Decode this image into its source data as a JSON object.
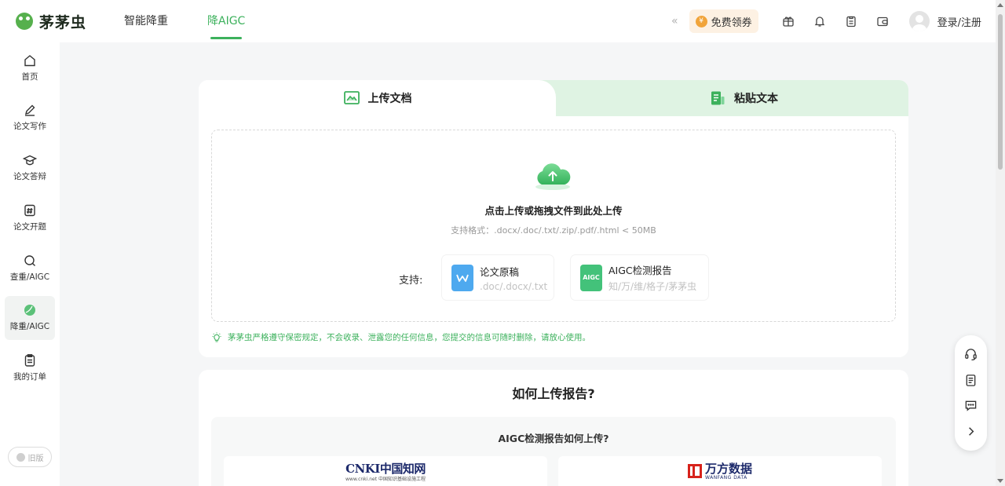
{
  "brand": {
    "name": "茅茅虫"
  },
  "nav": [
    {
      "label": "智能降重",
      "active": false
    },
    {
      "label": "降AIGC",
      "active": true
    }
  ],
  "topbar": {
    "collapse_glyph": "«",
    "coupon_label": "免费领券",
    "coupon_icon": "¥",
    "icons": [
      "gift-icon",
      "bell-icon",
      "clipboard-icon",
      "wallet-icon"
    ],
    "login_label": "登录/注册"
  },
  "sidebar": {
    "items": [
      {
        "label": "首页",
        "icon": "home-icon"
      },
      {
        "label": "论文写作",
        "icon": "pen-icon"
      },
      {
        "label": "论文答辩",
        "icon": "graduation-cap-icon"
      },
      {
        "label": "论文开题",
        "icon": "hash-icon"
      },
      {
        "label": "查重/AIGC",
        "icon": "magnifier-icon"
      },
      {
        "label": "降重/AIGC",
        "icon": "leaf-icon",
        "active": true
      },
      {
        "label": "我的订单",
        "icon": "order-icon"
      }
    ],
    "old_version_label": "旧版"
  },
  "upload": {
    "tab_upload": "上传文档",
    "tab_paste": "粘贴文本",
    "drop_title": "点击上传或拖拽文件到此处上传",
    "drop_formats": "支持格式：.docx/.doc/.txt/.zip/.pdf/.html < 50MB",
    "support_label": "支持:",
    "support_cards": [
      {
        "name": "论文原稿",
        "sub": ".doc/.docx/.txt",
        "icon": "word-doc-icon"
      },
      {
        "name": "AIGC检测报告",
        "sub": "知/万/维/格子/茅茅虫",
        "icon_text": "AIGC"
      }
    ],
    "notice": "茅茅虫严格遵守保密规定，不会收录、泄露您的任何信息，您提交的信息可随时删除，请放心使用。"
  },
  "howto": {
    "title": "如何上传报告?",
    "subtitle": "AIGC检测报告如何上传?",
    "cnki_logo": {
      "main": "CNKI中国知网",
      "sub": "www.cnki.net 中国知识基础设施工程"
    },
    "wanfang_logo": {
      "main": "万方数据",
      "sub": "WANFANG DATA"
    }
  },
  "float_bar": [
    "headset-icon",
    "document-icon",
    "chat-icon",
    "chevron-right-icon"
  ],
  "colors": {
    "accent": "#3cb15c",
    "tab_inactive_bg": "#dff3e3"
  }
}
